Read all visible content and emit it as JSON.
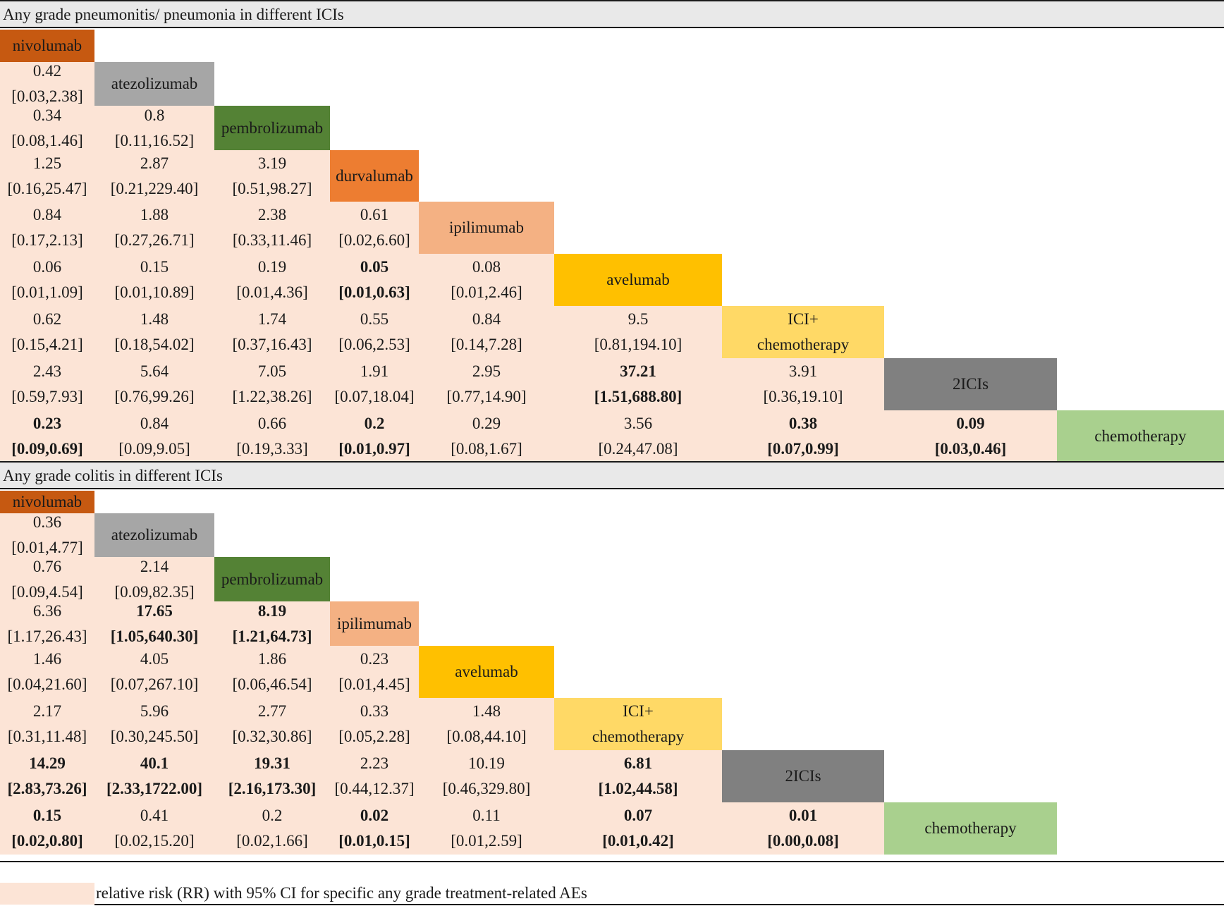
{
  "chart_data": [
    {
      "type": "table",
      "title": "Any grade pneumonitis/ pneumonia in different ICIs",
      "treatments": [
        {
          "name": "nivolumab",
          "color": "#c65911"
        },
        {
          "name": "atezolizumab",
          "color": "#a6a6a6"
        },
        {
          "name": "pembrolizumab",
          "color": "#548235"
        },
        {
          "name": "durvalumab",
          "color": "#ed7d31"
        },
        {
          "name": "ipilimumab",
          "color": "#f4b183"
        },
        {
          "name": "avelumab",
          "color": "#ffc000"
        },
        {
          "name": "ICI+ chemotherapy",
          "lines": [
            "ICI+",
            "chemotherapy"
          ],
          "color": "#ffd966"
        },
        {
          "name": "2ICIs",
          "color": "#808080"
        },
        {
          "name": "chemotherapy",
          "color": "#a9d08e"
        }
      ],
      "cells": [
        [],
        [
          {
            "rr": "0.42",
            "ci": "[0.03,2.38]",
            "sig": false
          }
        ],
        [
          {
            "rr": "0.34",
            "ci": "[0.08,1.46]",
            "sig": false
          },
          {
            "rr": "0.8",
            "ci": "[0.11,16.52]",
            "sig": false
          }
        ],
        [
          {
            "rr": "1.25",
            "ci": "[0.16,25.47]",
            "sig": false
          },
          {
            "rr": "2.87",
            "ci": "[0.21,229.40]",
            "sig": false
          },
          {
            "rr": "3.19",
            "ci": "[0.51,98.27]",
            "sig": false
          }
        ],
        [
          {
            "rr": "0.84",
            "ci": "[0.17,2.13]",
            "sig": false
          },
          {
            "rr": "1.88",
            "ci": "[0.27,26.71]",
            "sig": false
          },
          {
            "rr": "2.38",
            "ci": "[0.33,11.46]",
            "sig": false
          },
          {
            "rr": "0.61",
            "ci": "[0.02,6.60]",
            "sig": false
          }
        ],
        [
          {
            "rr": "0.06",
            "ci": "[0.01,1.09]",
            "sig": false
          },
          {
            "rr": "0.15",
            "ci": "[0.01,10.89]",
            "sig": false
          },
          {
            "rr": "0.19",
            "ci": "[0.01,4.36]",
            "sig": false
          },
          {
            "rr": "0.05",
            "ci": "[0.01,0.63]",
            "sig": true
          },
          {
            "rr": "0.08",
            "ci": "[0.01,2.46]",
            "sig": false
          }
        ],
        [
          {
            "rr": "0.62",
            "ci": "[0.15,4.21]",
            "sig": false
          },
          {
            "rr": "1.48",
            "ci": "[0.18,54.02]",
            "sig": false
          },
          {
            "rr": "1.74",
            "ci": "[0.37,16.43]",
            "sig": false
          },
          {
            "rr": "0.55",
            "ci": "[0.06,2.53]",
            "sig": false
          },
          {
            "rr": "0.84",
            "ci": "[0.14,7.28]",
            "sig": false
          },
          {
            "rr": "9.5",
            "ci": "[0.81,194.10]",
            "sig": false
          }
        ],
        [
          {
            "rr": "2.43",
            "ci": "[0.59,7.93]",
            "sig": false
          },
          {
            "rr": "5.64",
            "ci": "[0.76,99.26]",
            "sig": false
          },
          {
            "rr": "7.05",
            "ci": "[1.22,38.26]",
            "sig": false
          },
          {
            "rr": "1.91",
            "ci": "[0.07,18.04]",
            "sig": false
          },
          {
            "rr": "2.95",
            "ci": "[0.77,14.90]",
            "sig": false
          },
          {
            "rr": "37.21",
            "ci": "[1.51,688.80]",
            "sig": true
          },
          {
            "rr": "3.91",
            "ci": "[0.36,19.10]",
            "sig": false
          }
        ],
        [
          {
            "rr": "0.23",
            "ci": "[0.09,0.69]",
            "sig": true
          },
          {
            "rr": "0.84",
            "ci": "[0.09,9.05]",
            "sig": false
          },
          {
            "rr": "0.66",
            "ci": "[0.19,3.33]",
            "sig": false
          },
          {
            "rr": "0.2",
            "ci": "[0.01,0.97]",
            "sig": true
          },
          {
            "rr": "0.29",
            "ci": "[0.08,1.67]",
            "sig": false
          },
          {
            "rr": "3.56",
            "ci": "[0.24,47.08]",
            "sig": false
          },
          {
            "rr": "0.38",
            "ci": "[0.07,0.99]",
            "sig": true
          },
          {
            "rr": "0.09",
            "ci": "[0.03,0.46]",
            "sig": true
          }
        ]
      ]
    },
    {
      "type": "table",
      "title": "Any grade colitis in different ICIs",
      "treatments": [
        {
          "name": "nivolumab",
          "color": "#c65911"
        },
        {
          "name": "atezolizumab",
          "color": "#a6a6a6"
        },
        {
          "name": "pembrolizumab",
          "color": "#548235"
        },
        {
          "name": "ipilimumab",
          "color": "#f4b183"
        },
        {
          "name": "avelumab",
          "color": "#ffc000"
        },
        {
          "name": "ICI+ chemotherapy",
          "lines": [
            "ICI+",
            "chemotherapy"
          ],
          "color": "#ffd966"
        },
        {
          "name": "2ICIs",
          "color": "#808080"
        },
        {
          "name": "chemotherapy",
          "color": "#a9d08e"
        }
      ],
      "cells": [
        [],
        [
          {
            "rr": "0.36",
            "ci": "[0.01,4.77]",
            "sig": false
          }
        ],
        [
          {
            "rr": "0.76",
            "ci": "[0.09,4.54]",
            "sig": false
          },
          {
            "rr": "2.14",
            "ci": "[0.09,82.35]",
            "sig": false
          }
        ],
        [
          {
            "rr": "6.36",
            "ci": "[1.17,26.43]",
            "sig": false
          },
          {
            "rr": "17.65",
            "ci": "[1.05,640.30]",
            "sig": true
          },
          {
            "rr": "8.19",
            "ci": "[1.21,64.73]",
            "sig": true
          }
        ],
        [
          {
            "rr": "1.46",
            "ci": "[0.04,21.60]",
            "sig": false
          },
          {
            "rr": "4.05",
            "ci": "[0.07,267.10]",
            "sig": false
          },
          {
            "rr": "1.86",
            "ci": "[0.06,46.54]",
            "sig": false
          },
          {
            "rr": "0.23",
            "ci": "[0.01,4.45]",
            "sig": false
          }
        ],
        [
          {
            "rr": "2.17",
            "ci": "[0.31,11.48]",
            "sig": false
          },
          {
            "rr": "5.96",
            "ci": "[0.30,245.50]",
            "sig": false
          },
          {
            "rr": "2.77",
            "ci": "[0.32,30.86]",
            "sig": false
          },
          {
            "rr": "0.33",
            "ci": "[0.05,2.28]",
            "sig": false
          },
          {
            "rr": "1.48",
            "ci": "[0.08,44.10]",
            "sig": false
          }
        ],
        [
          {
            "rr": "14.29",
            "ci": "[2.83,73.26]",
            "sig": true
          },
          {
            "rr": "40.1",
            "ci": "[2.33,1722.00]",
            "sig": true
          },
          {
            "rr": "19.31",
            "ci": "[2.16,173.30]",
            "sig": true
          },
          {
            "rr": "2.23",
            "ci": "[0.44,12.37]",
            "sig": false
          },
          {
            "rr": "10.19",
            "ci": "[0.46,329.80]",
            "sig": false
          },
          {
            "rr": "6.81",
            "ci": "[1.02,44.58]",
            "sig": true
          }
        ],
        [
          {
            "rr": "0.15",
            "ci": "[0.02,0.80]",
            "sig": true
          },
          {
            "rr": "0.41",
            "ci": "[0.02,15.20]",
            "sig": false
          },
          {
            "rr": "0.2",
            "ci": "[0.02,1.66]",
            "sig": false
          },
          {
            "rr": "0.02",
            "ci": "[0.01,0.15]",
            "sig": true
          },
          {
            "rr": "0.11",
            "ci": "[0.01,2.59]",
            "sig": false
          },
          {
            "rr": "0.07",
            "ci": "[0.01,0.42]",
            "sig": true
          },
          {
            "rr": "0.01",
            "ci": "[0.00,0.08]",
            "sig": true
          }
        ]
      ]
    }
  ],
  "legend": {
    "swatch_color": "#fce4d6",
    "text": "relative risk (RR) with 95% CI  for specific any grade treatment-related AEs"
  }
}
